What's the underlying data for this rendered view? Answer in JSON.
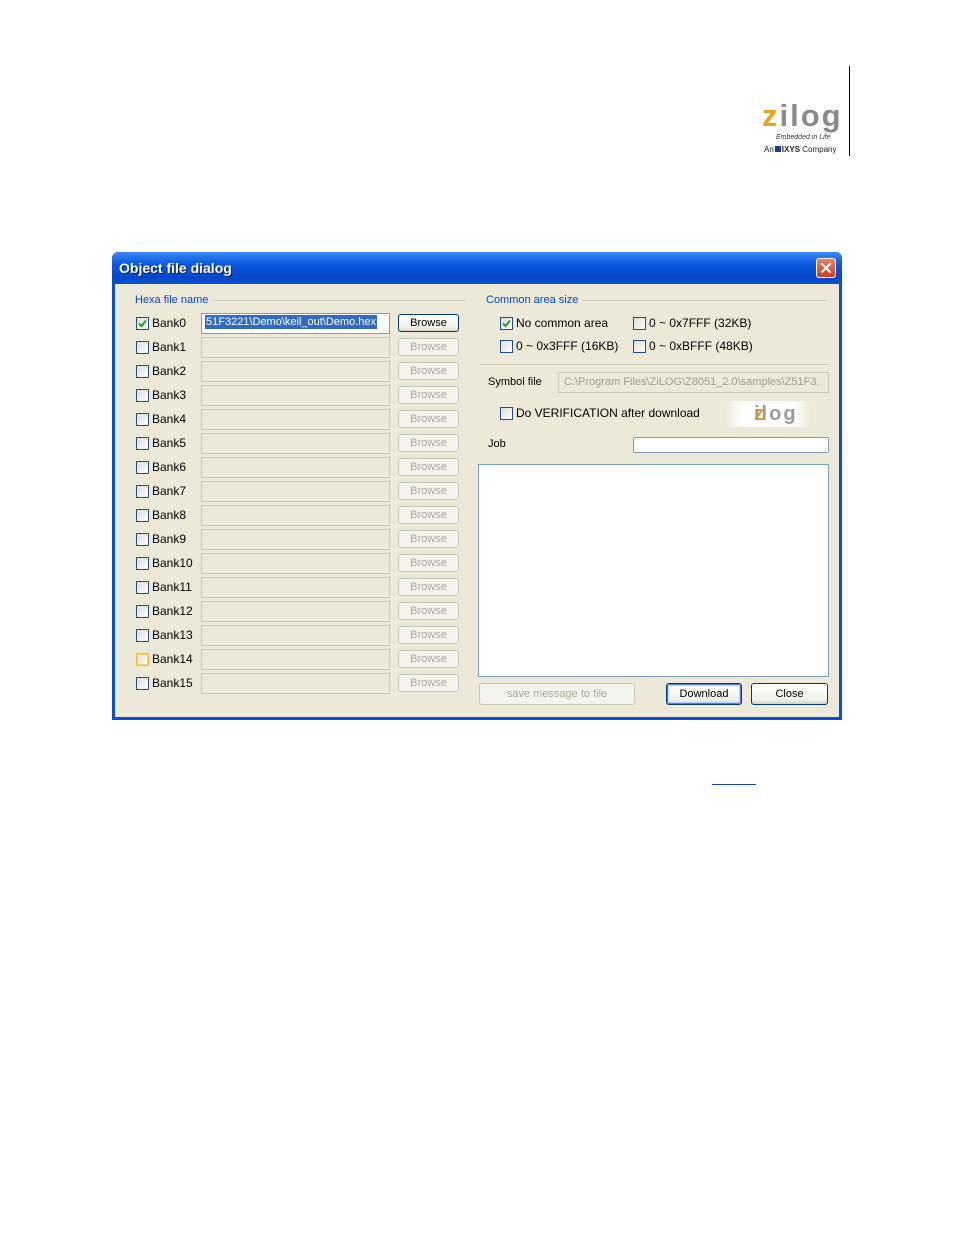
{
  "page": {
    "logo_text": "zilog",
    "logo_tagline": "Embedded in Life",
    "logo_company_prefix": "An",
    "logo_company_brand": "IXYS",
    "logo_company_suffix": "Company"
  },
  "dialog": {
    "title": "Object file dialog",
    "hexa_group_label": "Hexa file name",
    "browse_label": "Browse",
    "banks": [
      {
        "label": "Bank0",
        "checked": true,
        "path": "51F3221\\Demo\\keil_out\\Demo.hex",
        "enabled": true
      },
      {
        "label": "Bank1",
        "checked": false,
        "path": "",
        "enabled": false
      },
      {
        "label": "Bank2",
        "checked": false,
        "path": "",
        "enabled": false
      },
      {
        "label": "Bank3",
        "checked": false,
        "path": "",
        "enabled": false
      },
      {
        "label": "Bank4",
        "checked": false,
        "path": "",
        "enabled": false
      },
      {
        "label": "Bank5",
        "checked": false,
        "path": "",
        "enabled": false
      },
      {
        "label": "Bank6",
        "checked": false,
        "path": "",
        "enabled": false
      },
      {
        "label": "Bank7",
        "checked": false,
        "path": "",
        "enabled": false
      },
      {
        "label": "Bank8",
        "checked": false,
        "path": "",
        "enabled": false
      },
      {
        "label": "Bank9",
        "checked": false,
        "path": "",
        "enabled": false
      },
      {
        "label": "Bank10",
        "checked": false,
        "path": "",
        "enabled": false
      },
      {
        "label": "Bank11",
        "checked": false,
        "path": "",
        "enabled": false
      },
      {
        "label": "Bank12",
        "checked": false,
        "path": "",
        "enabled": false
      },
      {
        "label": "Bank13",
        "checked": false,
        "path": "",
        "enabled": false
      },
      {
        "label": "Bank14",
        "checked": false,
        "path": "",
        "enabled": false,
        "hover": true
      },
      {
        "label": "Bank15",
        "checked": false,
        "path": "",
        "enabled": false
      }
    ],
    "common_group_label": "Common area size",
    "common_options": [
      {
        "label": "No common area",
        "checked": true
      },
      {
        "label": "0 ~ 0x7FFF (32KB)",
        "checked": false
      },
      {
        "label": "0 ~ 0x3FFF (16KB)",
        "checked": false
      },
      {
        "label": "0 ~ 0xBFFF (48KB)",
        "checked": false
      }
    ],
    "symbol_label": "Symbol file",
    "symbol_value": "C:\\Program Files\\ZiLOG\\Z8051_2.0\\samples\\Z51F3.",
    "verify_label": "Do VERIFICATION after download",
    "verify_checked": false,
    "logo_text": "zilog",
    "job_label": "Job",
    "job_value": "",
    "log_text": "",
    "save_button": "save message to file",
    "download_button": "Download",
    "close_button": "Close"
  },
  "colors": {
    "titlebar": "#0a58e0",
    "group_label": "#0046d5",
    "dialog_bg": "#ece9d8",
    "selection": "#316ac5",
    "zilog_accent": "#e8a21b"
  }
}
